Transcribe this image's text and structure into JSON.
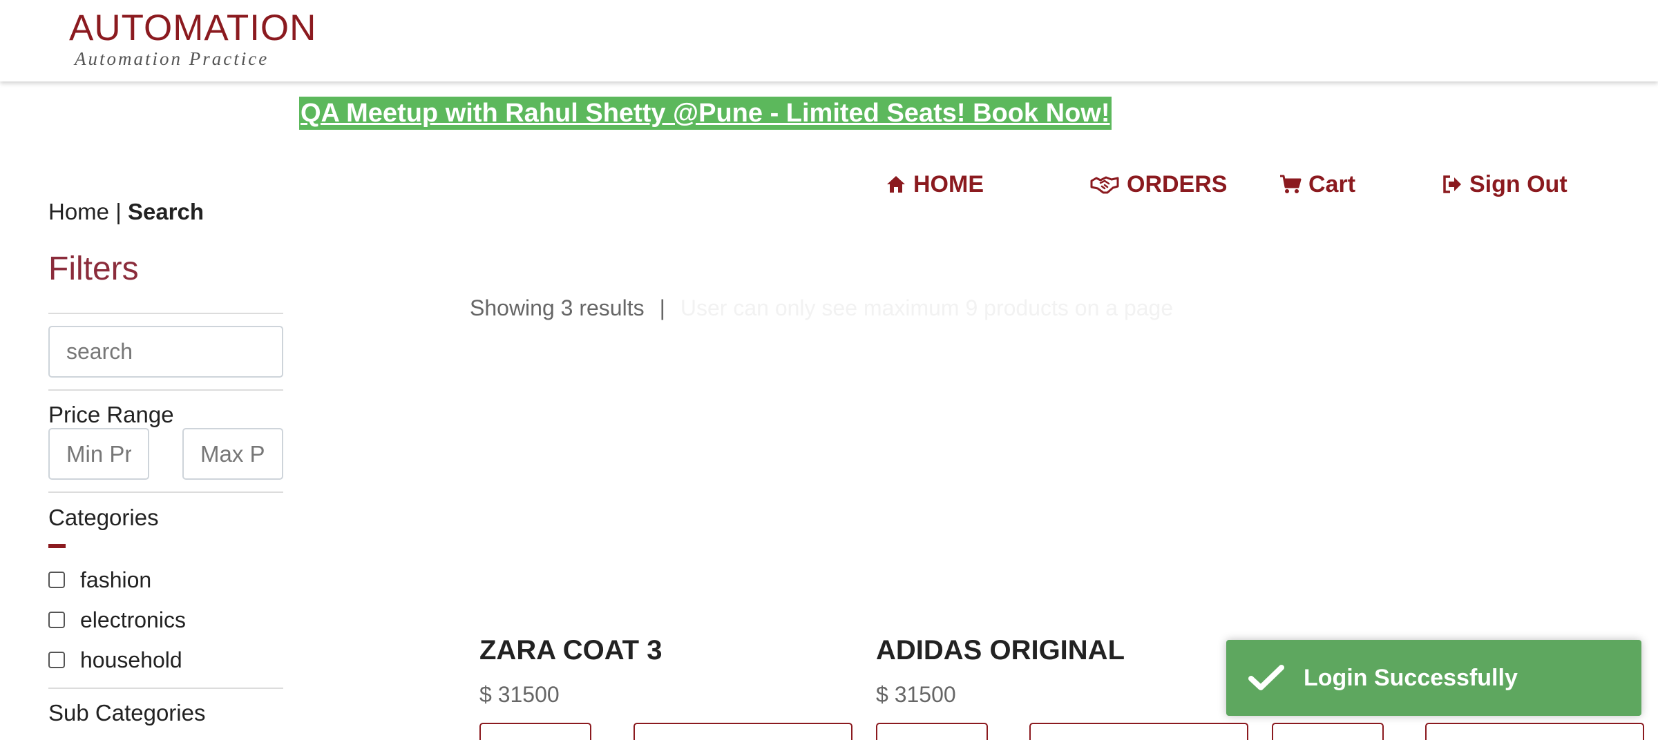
{
  "header": {
    "logo_title": "AUTOMATION",
    "logo_subtitle": "Automation Practice"
  },
  "banner": {
    "text": "QA Meetup with Rahul Shetty @Pune - Limited Seats! Book Now!",
    "color": "#5cb85c"
  },
  "nav": {
    "home": "HOME",
    "orders": "ORDERS",
    "cart": "Cart",
    "sign_out": "Sign Out",
    "accent_color": "#8b1a1f"
  },
  "breadcrumb": {
    "home": "Home",
    "separator": "|",
    "current": "Search"
  },
  "filters": {
    "title": "Filters",
    "search_placeholder": "search",
    "price_range_label": "Price Range",
    "min_price_placeholder": "Min Price",
    "max_price_placeholder": "Max Price",
    "categories_label": "Categories",
    "categories": [
      {
        "label": "fashion",
        "checked": false
      },
      {
        "label": "electronics",
        "checked": false
      },
      {
        "label": "household",
        "checked": false
      }
    ],
    "sub_categories_label": "Sub Categories"
  },
  "results": {
    "count_text": "Showing 3 results",
    "separator": "|",
    "faint_text": "User can only see maximum 9 products on a page"
  },
  "products": [
    {
      "name": "ZARA COAT 3",
      "price": "$ 31500"
    },
    {
      "name": "ADIDAS ORIGINAL",
      "price": "$ 31500"
    }
  ],
  "toast": {
    "message": "Login Successfully",
    "icon": "check-icon",
    "color": "#5ea75f"
  }
}
